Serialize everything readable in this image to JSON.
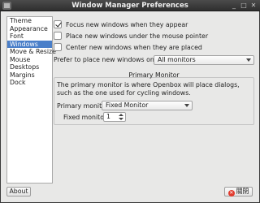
{
  "window": {
    "title": "Window Manager Preferences",
    "controls": {
      "minimize": "_",
      "maximize": "□",
      "close": "✕"
    }
  },
  "sidebar": {
    "items": [
      {
        "label": "Theme",
        "selected": false
      },
      {
        "label": "Appearance",
        "selected": false
      },
      {
        "label": "Font",
        "selected": false
      },
      {
        "label": "Windows",
        "selected": true
      },
      {
        "label": "Move & Resize",
        "selected": false
      },
      {
        "label": "Mouse",
        "selected": false
      },
      {
        "label": "Desktops",
        "selected": false
      },
      {
        "label": "Margins",
        "selected": false
      },
      {
        "label": "Dock",
        "selected": false
      }
    ]
  },
  "windows": {
    "focus_new": {
      "label": "Focus new windows when they appear",
      "checked": true
    },
    "place_under_mouse": {
      "label": "Place new windows under the mouse pointer",
      "checked": false
    },
    "center_new": {
      "label": "Center new windows when they are placed",
      "checked": false
    },
    "prefer_label": "Prefer to place new windows on:",
    "prefer_value": "All monitors",
    "primary_monitor": {
      "header": "Primary Monitor",
      "description": "The primary monitor is where Openbox will place dialogs, such as the one used for cycling windows.",
      "primary_label": "Primary monitor:",
      "primary_value": "Fixed Monitor",
      "fixed_label": "Fixed monitor:",
      "fixed_value": "1"
    }
  },
  "footer": {
    "about_label": "About",
    "close_label": "關閉"
  },
  "colors": {
    "accent": "#4a7fc9",
    "titlebar": "#3a3a3a",
    "close_icon": "#e23b2e"
  }
}
